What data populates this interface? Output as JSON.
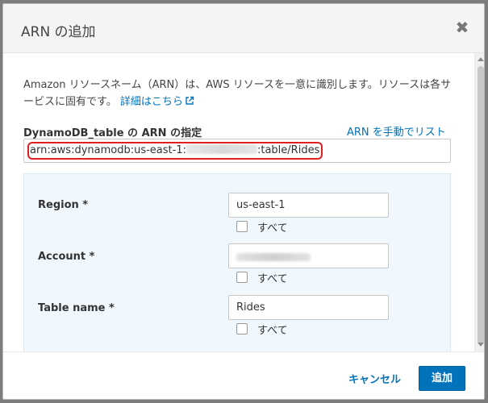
{
  "dialog": {
    "title": "ARN の追加",
    "close_glyph": "✖"
  },
  "description": {
    "text": "Amazon リソースネーム（ARN）は、AWS リソースを一意に識別します。リソースは各サービスに固有です。",
    "link_label": "詳細はこちら"
  },
  "arn_field": {
    "label": "DynamoDB_table の ARN の指定",
    "manual_link": "ARN を手動でリスト",
    "value_prefix": "arn:aws:dynamodb:us-east-1:",
    "value_suffix": ":table/Rides"
  },
  "rows": {
    "region": {
      "label": "Region *",
      "value": "us-east-1",
      "checkbox_label": "すべて"
    },
    "account": {
      "label": "Account *",
      "checkbox_label": "すべて"
    },
    "table": {
      "label": "Table name *",
      "value": "Rides",
      "checkbox_label": "すべて"
    }
  },
  "footer": {
    "cancel_label": "キャンセル",
    "add_label": "追加"
  },
  "colors": {
    "link": "#0073bb",
    "primary_button": "#0073bb",
    "highlight": "#e02020",
    "panel_bg": "#f1f8fd"
  },
  "icons": [
    "close-icon",
    "external-link-icon"
  ]
}
